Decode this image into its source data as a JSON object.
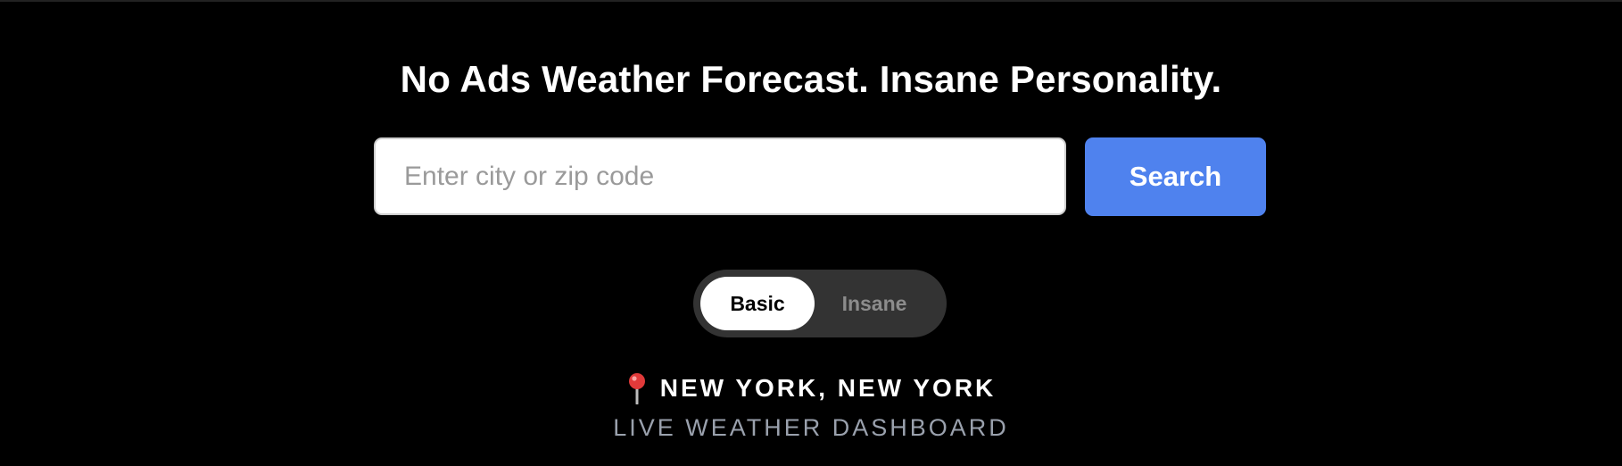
{
  "header": {
    "title": "No Ads Weather Forecast. Insane Personality."
  },
  "search": {
    "placeholder": "Enter city or zip code",
    "value": "",
    "button_label": "Search"
  },
  "mode_toggle": {
    "options": [
      {
        "label": "Basic",
        "selected": true
      },
      {
        "label": "Insane",
        "selected": false
      }
    ]
  },
  "location": {
    "icon": "pin-icon",
    "name": "NEW YORK, NEW YORK",
    "subtitle": "LIVE WEATHER DASHBOARD"
  },
  "colors": {
    "background": "#000000",
    "accent": "#4f82ee",
    "toggle_track": "#333333",
    "toggle_selected": "#ffffff",
    "subtitle_text": "#9aa1ad",
    "pin": "#e03a3a"
  }
}
